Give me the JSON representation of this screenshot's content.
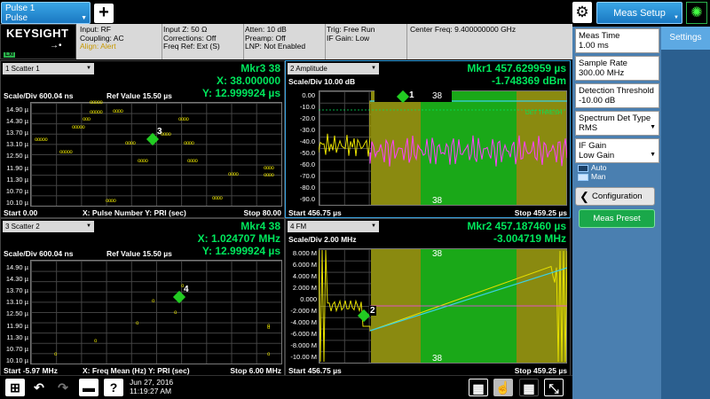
{
  "tabs": {
    "pulse_line1": "Pulse 1",
    "pulse_line2": "Pulse"
  },
  "brand": {
    "name": "KEYSIGHT",
    "badge": "LXI"
  },
  "info": {
    "col1": [
      "Input: RF",
      "Coupling: AC",
      "Align: Alert"
    ],
    "col2": [
      "Input Z: 50 Ω",
      "Corrections: Off",
      "Freq Ref: Ext (S)"
    ],
    "col3": [
      "Atten: 10 dB",
      "Preamp: Off",
      "LNP: Not Enabled"
    ],
    "col4": [
      "Trig: Free Run",
      "IF Gain: Low"
    ],
    "col5": [
      "Center Freq: 9.400000000 GHz"
    ]
  },
  "right": {
    "menu_label": "Meas Setup",
    "settings_tab": "Settings",
    "params": [
      {
        "label": "Meas Time",
        "value": "1.00 ms"
      },
      {
        "label": "Sample Rate",
        "value": "300.00 MHz"
      },
      {
        "label": "Detection Threshold",
        "value": "-10.00 dB"
      },
      {
        "label": "Spectrum Det Type",
        "value": "RMS"
      },
      {
        "label": "IF Gain",
        "value": "Low Gain"
      }
    ],
    "radio_auto": "Auto",
    "radio_man": "Man",
    "configuration": "Configuration",
    "preset": "Meas Preset"
  },
  "win1": {
    "title": "1 Scatter 1",
    "mkr": "Mkr3 38",
    "mkr_x": "X: 38.000000",
    "mkr_y": "Y: 12.999924 µs",
    "scale": "Scale/Div 600.04 ns",
    "ref": "Ref Value 15.50 µs",
    "yticks": [
      "14.90 µ",
      "14.30 µ",
      "13.70 µ",
      "13.10 µ",
      "12.50 µ",
      "11.90 µ",
      "11.30 µ",
      "10.70 µ",
      "10.10 µ"
    ],
    "start": "Start 0.00",
    "axes": "X: Pulse Number  Y: PRI (sec)",
    "stop": "Stop 80.00",
    "marker": "3"
  },
  "win2": {
    "title": "2 Amplitude",
    "mkr": "Mkr1  457.629959 µs",
    "mkr_y": "-1.748369 dBm",
    "scale": "Scale/Div 10.00 dB",
    "yticks": [
      "0.00",
      "-10.0",
      "-20.0",
      "-30.0",
      "-40.0",
      "-50.0",
      "-60.0",
      "-70.0",
      "-80.0",
      "-90.0"
    ],
    "start": "Start 456.75 µs",
    "stop": "Stop 459.25 µs",
    "pulse_num_top": "38",
    "pulse_num_bottom": "38",
    "thresh": "DET THRESH",
    "marker": "1"
  },
  "win3": {
    "title": "3 Scatter 2",
    "mkr": "Mkr4  38",
    "mkr_x": "X: 1.024707 MHz",
    "mkr_y": "Y: 12.999924 µs",
    "scale": "Scale/Div 600.04 ns",
    "ref": "Ref Value 15.50 µs",
    "yticks": [
      "14.90 µ",
      "14.30 µ",
      "13.70 µ",
      "13.10 µ",
      "12.50 µ",
      "11.90 µ",
      "11.30 µ",
      "10.70 µ",
      "10.10 µ"
    ],
    "start": "Start -5.97 MHz",
    "axes": "X: Freq Mean (Hz)  Y: PRI (sec)",
    "stop": "Stop 6.00 MHz",
    "marker": "4"
  },
  "win4": {
    "title": "4 FM",
    "mkr": "Mkr2  457.187460 µs",
    "mkr_y": "-3.004719 MHz",
    "scale": "Scale/Div 2.00 MHz",
    "yticks": [
      "8.000 M",
      "6.000 M",
      "4.000 M",
      "2.000 M",
      "0.000",
      "-2.000 M",
      "-4.000 M",
      "-6.000 M",
      "-8.000 M",
      "-10.00 M"
    ],
    "start": "Start 456.75 µs",
    "stop": "Stop 459.25 µs",
    "pulse_num_top": "38",
    "pulse_num_bottom": "38",
    "marker": "2"
  },
  "taskbar": {
    "date": "Jun 27, 2016",
    "time": "11:19:27 AM"
  },
  "colors": {
    "accent": "#1a78c2",
    "trace": "#00e65c",
    "marker": "#22cc22",
    "band_yellow": "#8a8a10",
    "band_green": "#1aa818"
  }
}
